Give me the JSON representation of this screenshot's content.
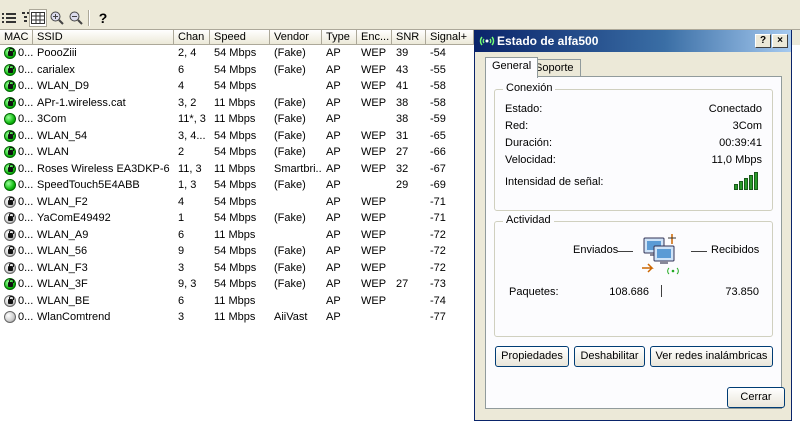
{
  "toolbar": {
    "icons": [
      "list-view-icon",
      "grid-view-icon",
      "zoom-in-icon",
      "zoom-out-icon",
      "help-icon"
    ],
    "help_glyph": "?"
  },
  "grid": {
    "columns": [
      "MAC",
      "SSID",
      "Chan",
      "Speed",
      "Vendor",
      "Type",
      "Enc...",
      "SNR",
      "Signal+"
    ],
    "rows": [
      {
        "mac": "0...",
        "ssid": "PoooZiii",
        "chan": "2, 4",
        "speed": "54 Mbps",
        "vendor": "(Fake)",
        "type": "AP",
        "enc": "WEP",
        "snr": "39",
        "signal": "-54",
        "icon": "green",
        "locked": true
      },
      {
        "mac": "0...",
        "ssid": "carialex",
        "chan": "6",
        "speed": "54 Mbps",
        "vendor": "(Fake)",
        "type": "AP",
        "enc": "WEP",
        "snr": "43",
        "signal": "-55",
        "icon": "green",
        "locked": true
      },
      {
        "mac": "0...",
        "ssid": "WLAN_D9",
        "chan": "4",
        "speed": "54 Mbps",
        "vendor": "",
        "type": "AP",
        "enc": "WEP",
        "snr": "41",
        "signal": "-58",
        "icon": "green",
        "locked": true
      },
      {
        "mac": "0...",
        "ssid": "APr-1.wireless.cat",
        "chan": "3, 2",
        "speed": "11 Mbps",
        "vendor": "(Fake)",
        "type": "AP",
        "enc": "WEP",
        "snr": "38",
        "signal": "-58",
        "icon": "green",
        "locked": true
      },
      {
        "mac": "0...",
        "ssid": "3Com",
        "chan": "11*, 3",
        "speed": "11 Mbps",
        "vendor": "(Fake)",
        "type": "AP",
        "enc": "",
        "snr": "38",
        "signal": "-59",
        "icon": "green",
        "locked": false
      },
      {
        "mac": "0...",
        "ssid": "WLAN_54",
        "chan": "3, 4...",
        "speed": "54 Mbps",
        "vendor": "(Fake)",
        "type": "AP",
        "enc": "WEP",
        "snr": "31",
        "signal": "-65",
        "icon": "green",
        "locked": true
      },
      {
        "mac": "0...",
        "ssid": "WLAN",
        "chan": "2",
        "speed": "54 Mbps",
        "vendor": "(Fake)",
        "type": "AP",
        "enc": "WEP",
        "snr": "27",
        "signal": "-66",
        "icon": "green",
        "locked": true
      },
      {
        "mac": "0...",
        "ssid": "Roses Wireless EA3DKP-6",
        "chan": "11, 3",
        "speed": "11 Mbps",
        "vendor": "Smartbri...",
        "type": "AP",
        "enc": "WEP",
        "snr": "32",
        "signal": "-67",
        "icon": "green",
        "locked": true
      },
      {
        "mac": "0...",
        "ssid": "SpeedTouch5E4ABB",
        "chan": "1, 3",
        "speed": "54 Mbps",
        "vendor": "(Fake)",
        "type": "AP",
        "enc": "",
        "snr": "29",
        "signal": "-69",
        "icon": "green",
        "locked": false
      },
      {
        "mac": "0...",
        "ssid": "WLAN_F2",
        "chan": "4",
        "speed": "54 Mbps",
        "vendor": "",
        "type": "AP",
        "enc": "WEP",
        "snr": "",
        "signal": "-71",
        "icon": "gray",
        "locked": true
      },
      {
        "mac": "0...",
        "ssid": "YaComE49492",
        "chan": "1",
        "speed": "54 Mbps",
        "vendor": "(Fake)",
        "type": "AP",
        "enc": "WEP",
        "snr": "",
        "signal": "-71",
        "icon": "gray",
        "locked": true
      },
      {
        "mac": "0...",
        "ssid": "WLAN_A9",
        "chan": "6",
        "speed": "11 Mbps",
        "vendor": "",
        "type": "AP",
        "enc": "WEP",
        "snr": "",
        "signal": "-72",
        "icon": "gray",
        "locked": true
      },
      {
        "mac": "0...",
        "ssid": "WLAN_56",
        "chan": "9",
        "speed": "54 Mbps",
        "vendor": "(Fake)",
        "type": "AP",
        "enc": "WEP",
        "snr": "",
        "signal": "-72",
        "icon": "gray",
        "locked": true
      },
      {
        "mac": "0...",
        "ssid": "WLAN_F3",
        "chan": "3",
        "speed": "54 Mbps",
        "vendor": "(Fake)",
        "type": "AP",
        "enc": "WEP",
        "snr": "",
        "signal": "-72",
        "icon": "gray",
        "locked": true
      },
      {
        "mac": "0...",
        "ssid": "WLAN_3F",
        "chan": "9, 3",
        "speed": "54 Mbps",
        "vendor": "(Fake)",
        "type": "AP",
        "enc": "WEP",
        "snr": "27",
        "signal": "-73",
        "icon": "green",
        "locked": true
      },
      {
        "mac": "0...",
        "ssid": "WLAN_BE",
        "chan": "6",
        "speed": "11 Mbps",
        "vendor": "",
        "type": "AP",
        "enc": "WEP",
        "snr": "",
        "signal": "-74",
        "icon": "gray",
        "locked": true
      },
      {
        "mac": "0...",
        "ssid": "WlanComtrend",
        "chan": "3",
        "speed": "11 Mbps",
        "vendor": "AiiVast",
        "type": "AP",
        "enc": "",
        "snr": "",
        "signal": "-77",
        "icon": "gray",
        "locked": false
      }
    ]
  },
  "dialog": {
    "title": "Estado de alfa500",
    "help_btn": "?",
    "close_btn": "×",
    "tabs": [
      {
        "label": "General",
        "active": true
      },
      {
        "label": "Soporte",
        "active": false
      }
    ],
    "connection": {
      "legend": "Conexión",
      "fields": [
        {
          "label": "Estado:",
          "value": "Conectado"
        },
        {
          "label": "Red:",
          "value": "3Com"
        },
        {
          "label": "Duración:",
          "value": "00:39:41"
        },
        {
          "label": "Velocidad:",
          "value": "11,0 Mbps"
        }
      ],
      "signal_label": "Intensidad de señal:",
      "signal_bars_lit": 5,
      "signal_bars_total": 5
    },
    "activity": {
      "legend": "Actividad",
      "sent_label": "Enviados",
      "received_label": "Recibidos",
      "packets_label": "Paquetes:",
      "packets_sent": "108.686",
      "packets_received": "73.850"
    },
    "buttons": {
      "properties": "Propiedades",
      "disable": "Deshabilitar",
      "view_networks": "Ver redes inalámbricas",
      "close": "Cerrar"
    },
    "colors": {
      "titlebar": "#0a246a",
      "signal": "#2a9a2a"
    }
  }
}
